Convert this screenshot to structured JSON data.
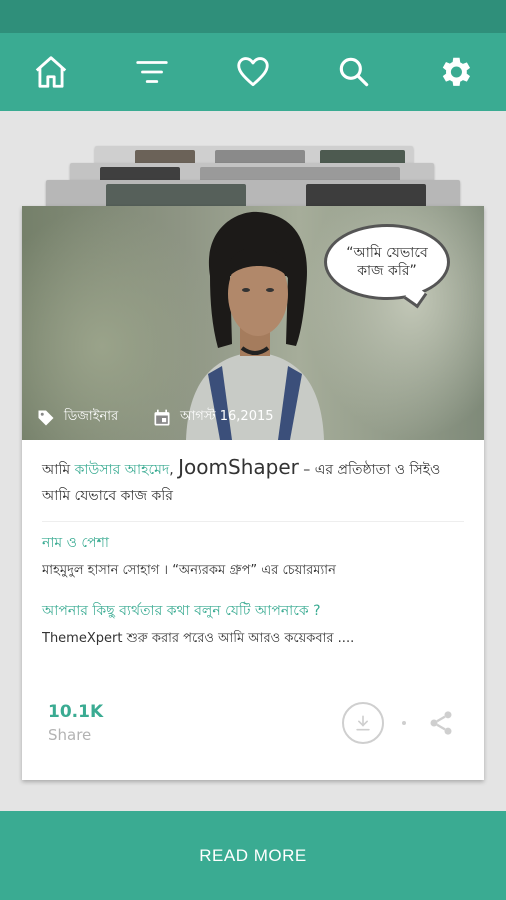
{
  "nav": {
    "items": [
      {
        "name": "home-icon"
      },
      {
        "name": "filter-icon"
      },
      {
        "name": "heart-icon"
      },
      {
        "name": "search-icon"
      },
      {
        "name": "gear-icon"
      }
    ]
  },
  "card": {
    "hero": {
      "speech_line1": "“আমি যেভাবে",
      "speech_line2": "কাজ করি”",
      "category": "ডিজাইনার",
      "date": "আগস্ট 16,2015"
    },
    "title": {
      "prefix": "আমি ",
      "author": "কাউসার আহমেদ",
      "comma": ", ",
      "brand": "JoomShaper",
      "rest": " – এর প্রতিষ্ঠাতা ও সিইও আমি যেভাবে কাজ করি"
    },
    "qa": [
      {
        "q": "নাম ও পেশা",
        "a": "মাহমুদুল হাসান সোহাগ । “অন্যরকম গ্রুপ” এর চেয়ারম্যান"
      },
      {
        "q": "আপনার কিছু ব্যর্থতার কথা বলুন যেটি আপনাকে ?",
        "a": "ThemeXpert শুরু করার পরেও আমি আরও কয়েকবার ...."
      }
    ],
    "stats": {
      "count": "10.1K",
      "label": "Share"
    }
  },
  "read_more": "READ MORE",
  "colors": {
    "accent": "#3aab92",
    "status_bar": "#2f8f7a"
  }
}
